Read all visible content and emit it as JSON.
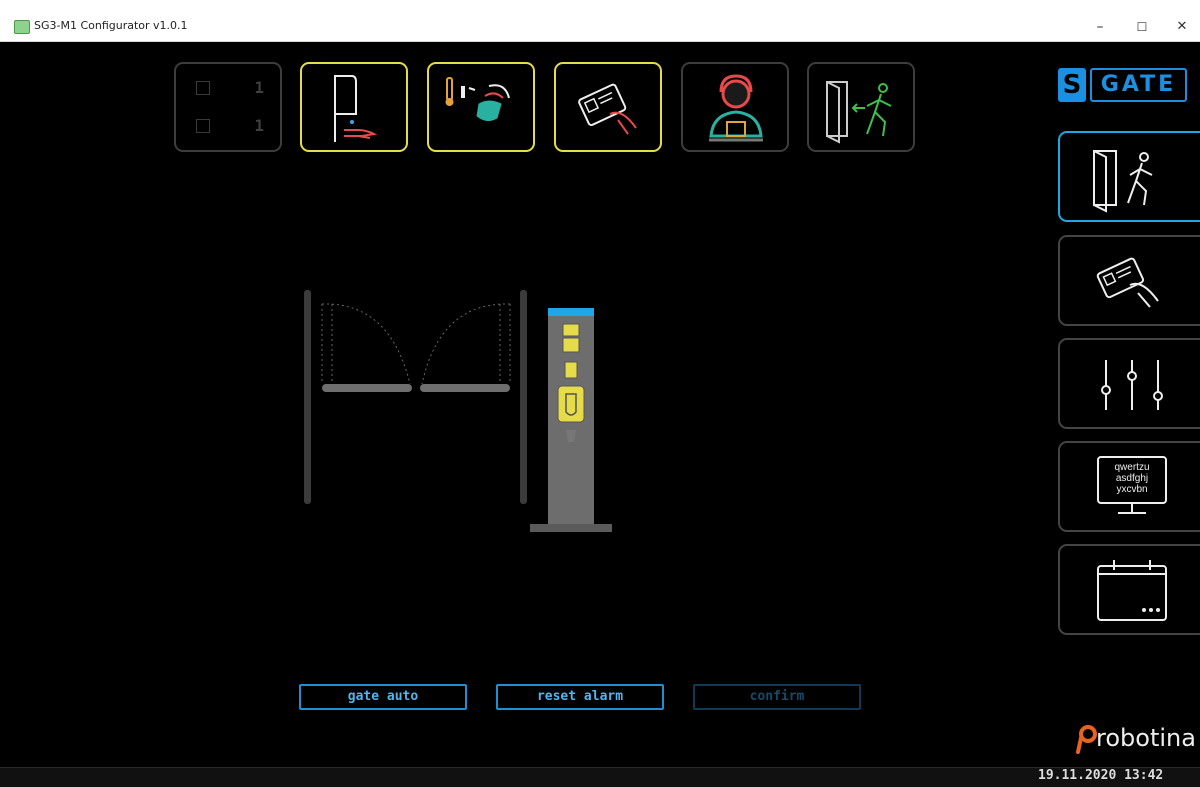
{
  "window": {
    "title": "SG3-M1 Configurator v1.0.1",
    "minimize": "–",
    "maximize": "☐",
    "close": "✕"
  },
  "top_tiles": {
    "counter": {
      "entries_count": "1",
      "exits_count": "1"
    },
    "items": [
      {
        "icon": "hand-sanitizer-icon",
        "active": true
      },
      {
        "icon": "temperature-mask-check-icon",
        "active": true
      },
      {
        "icon": "card-reader-icon",
        "active": true
      },
      {
        "icon": "operator-headset-icon",
        "active": false
      },
      {
        "icon": "exit-door-icon",
        "active": false
      }
    ]
  },
  "logo": {
    "s": "S",
    "gate": "GATE"
  },
  "sidebar": {
    "items": [
      {
        "icon": "door-walk-icon",
        "selected": true
      },
      {
        "icon": "card-icon",
        "selected": false
      },
      {
        "icon": "sliders-icon",
        "selected": false
      },
      {
        "icon": "keyboard-icon",
        "keyboard_lines": [
          "qwertzu",
          "asdfghj",
          "yxcvbn"
        ],
        "selected": false
      },
      {
        "icon": "calendar-icon",
        "selected": false
      }
    ]
  },
  "actions": {
    "gate_auto": "gate auto",
    "reset_alarm": "reset alarm",
    "confirm": "confirm"
  },
  "brand": {
    "name": "robotina"
  },
  "status": {
    "datetime": "19.11.2020 13:42"
  },
  "colors": {
    "accent_yellow": "#e6dc4a",
    "accent_blue": "#1ea7e6",
    "logo_blue": "#1b8fe0",
    "brand_orange": "#e8641e",
    "inactive_border": "#3d3d3d"
  }
}
